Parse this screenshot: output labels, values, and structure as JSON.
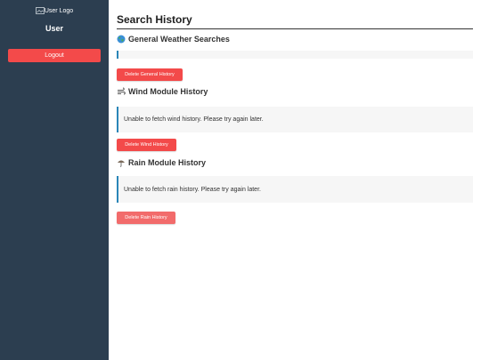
{
  "sidebar": {
    "logo_alt": "User Logo",
    "user_label": "User",
    "logout_label": "Logout"
  },
  "main": {
    "page_title": "Search History",
    "sections": [
      {
        "icon": "globe-icon",
        "title": "General Weather Searches",
        "message": "",
        "delete_label": "Delete General History"
      },
      {
        "icon": "wind-icon",
        "title": "Wind Module History",
        "message": "Unable to fetch wind history. Please try again later.",
        "delete_label": "Delete Wind History"
      },
      {
        "icon": "rain-icon",
        "title": "Rain Module History",
        "message": "Unable to fetch rain history. Please try again later.",
        "delete_label": "Delete Rain History"
      }
    ]
  },
  "colors": {
    "sidebar_bg": "#2c3e50",
    "danger": "#f34a4a",
    "danger_muted": "#f26b6b",
    "info_border": "#2a86b8"
  }
}
